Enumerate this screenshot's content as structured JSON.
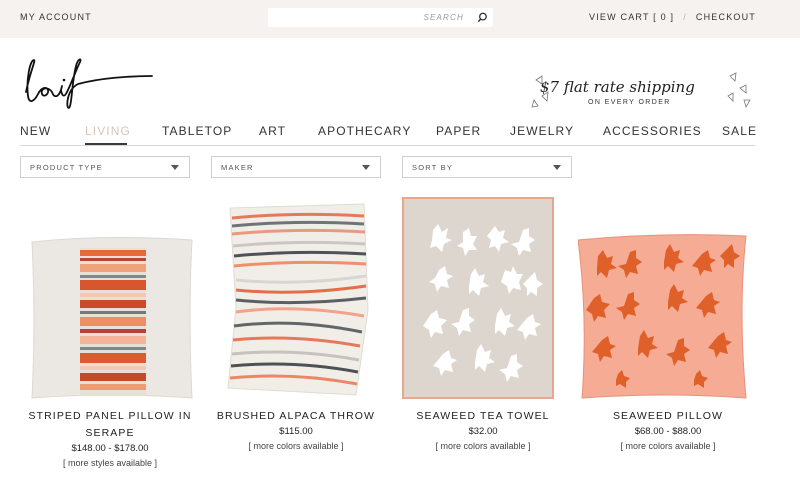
{
  "header": {
    "account_label": "MY ACCOUNT",
    "search_placeholder": "SEARCH",
    "cart_label": "VIEW CART [ 0 ]",
    "separator": "/",
    "checkout_label": "CHECKOUT"
  },
  "brand": {
    "logo_text": "leif",
    "promo_text": "$7 flat rate shipping",
    "promo_subtext": "ON EVERY ORDER"
  },
  "nav": {
    "items": [
      "NEW",
      "LIVING",
      "TABLETOP",
      "ART",
      "APOTHECARY",
      "PAPER",
      "JEWELRY",
      "ACCESSORIES",
      "SALE"
    ],
    "active": "LIVING"
  },
  "filters": [
    {
      "label": "PRODUCT TYPE"
    },
    {
      "label": "MAKER"
    },
    {
      "label": "SORT BY"
    }
  ],
  "products": [
    {
      "name_line1": "STRIPED PANEL PILLOW IN",
      "name_line2": "SERAPE",
      "price": "$148.00 - $178.00",
      "note": "[ more styles available ]"
    },
    {
      "name_line1": "BRUSHED ALPACA THROW",
      "name_line2": "",
      "price": "$115.00",
      "note": "[ more colors available ]"
    },
    {
      "name_line1": "SEAWEED TEA TOWEL",
      "name_line2": "",
      "price": "$32.00",
      "note": "[ more colors available ]"
    },
    {
      "name_line1": "SEAWEED PILLOW",
      "name_line2": "",
      "price": "$68.00 - $88.00",
      "note": "[ more colors available ]"
    }
  ],
  "colors": {
    "topbar_bg": "#f6f2f0",
    "active_nav": "#d7c7b6",
    "coral": "#f2a48c",
    "seaweed_orange": "#e0602a"
  }
}
